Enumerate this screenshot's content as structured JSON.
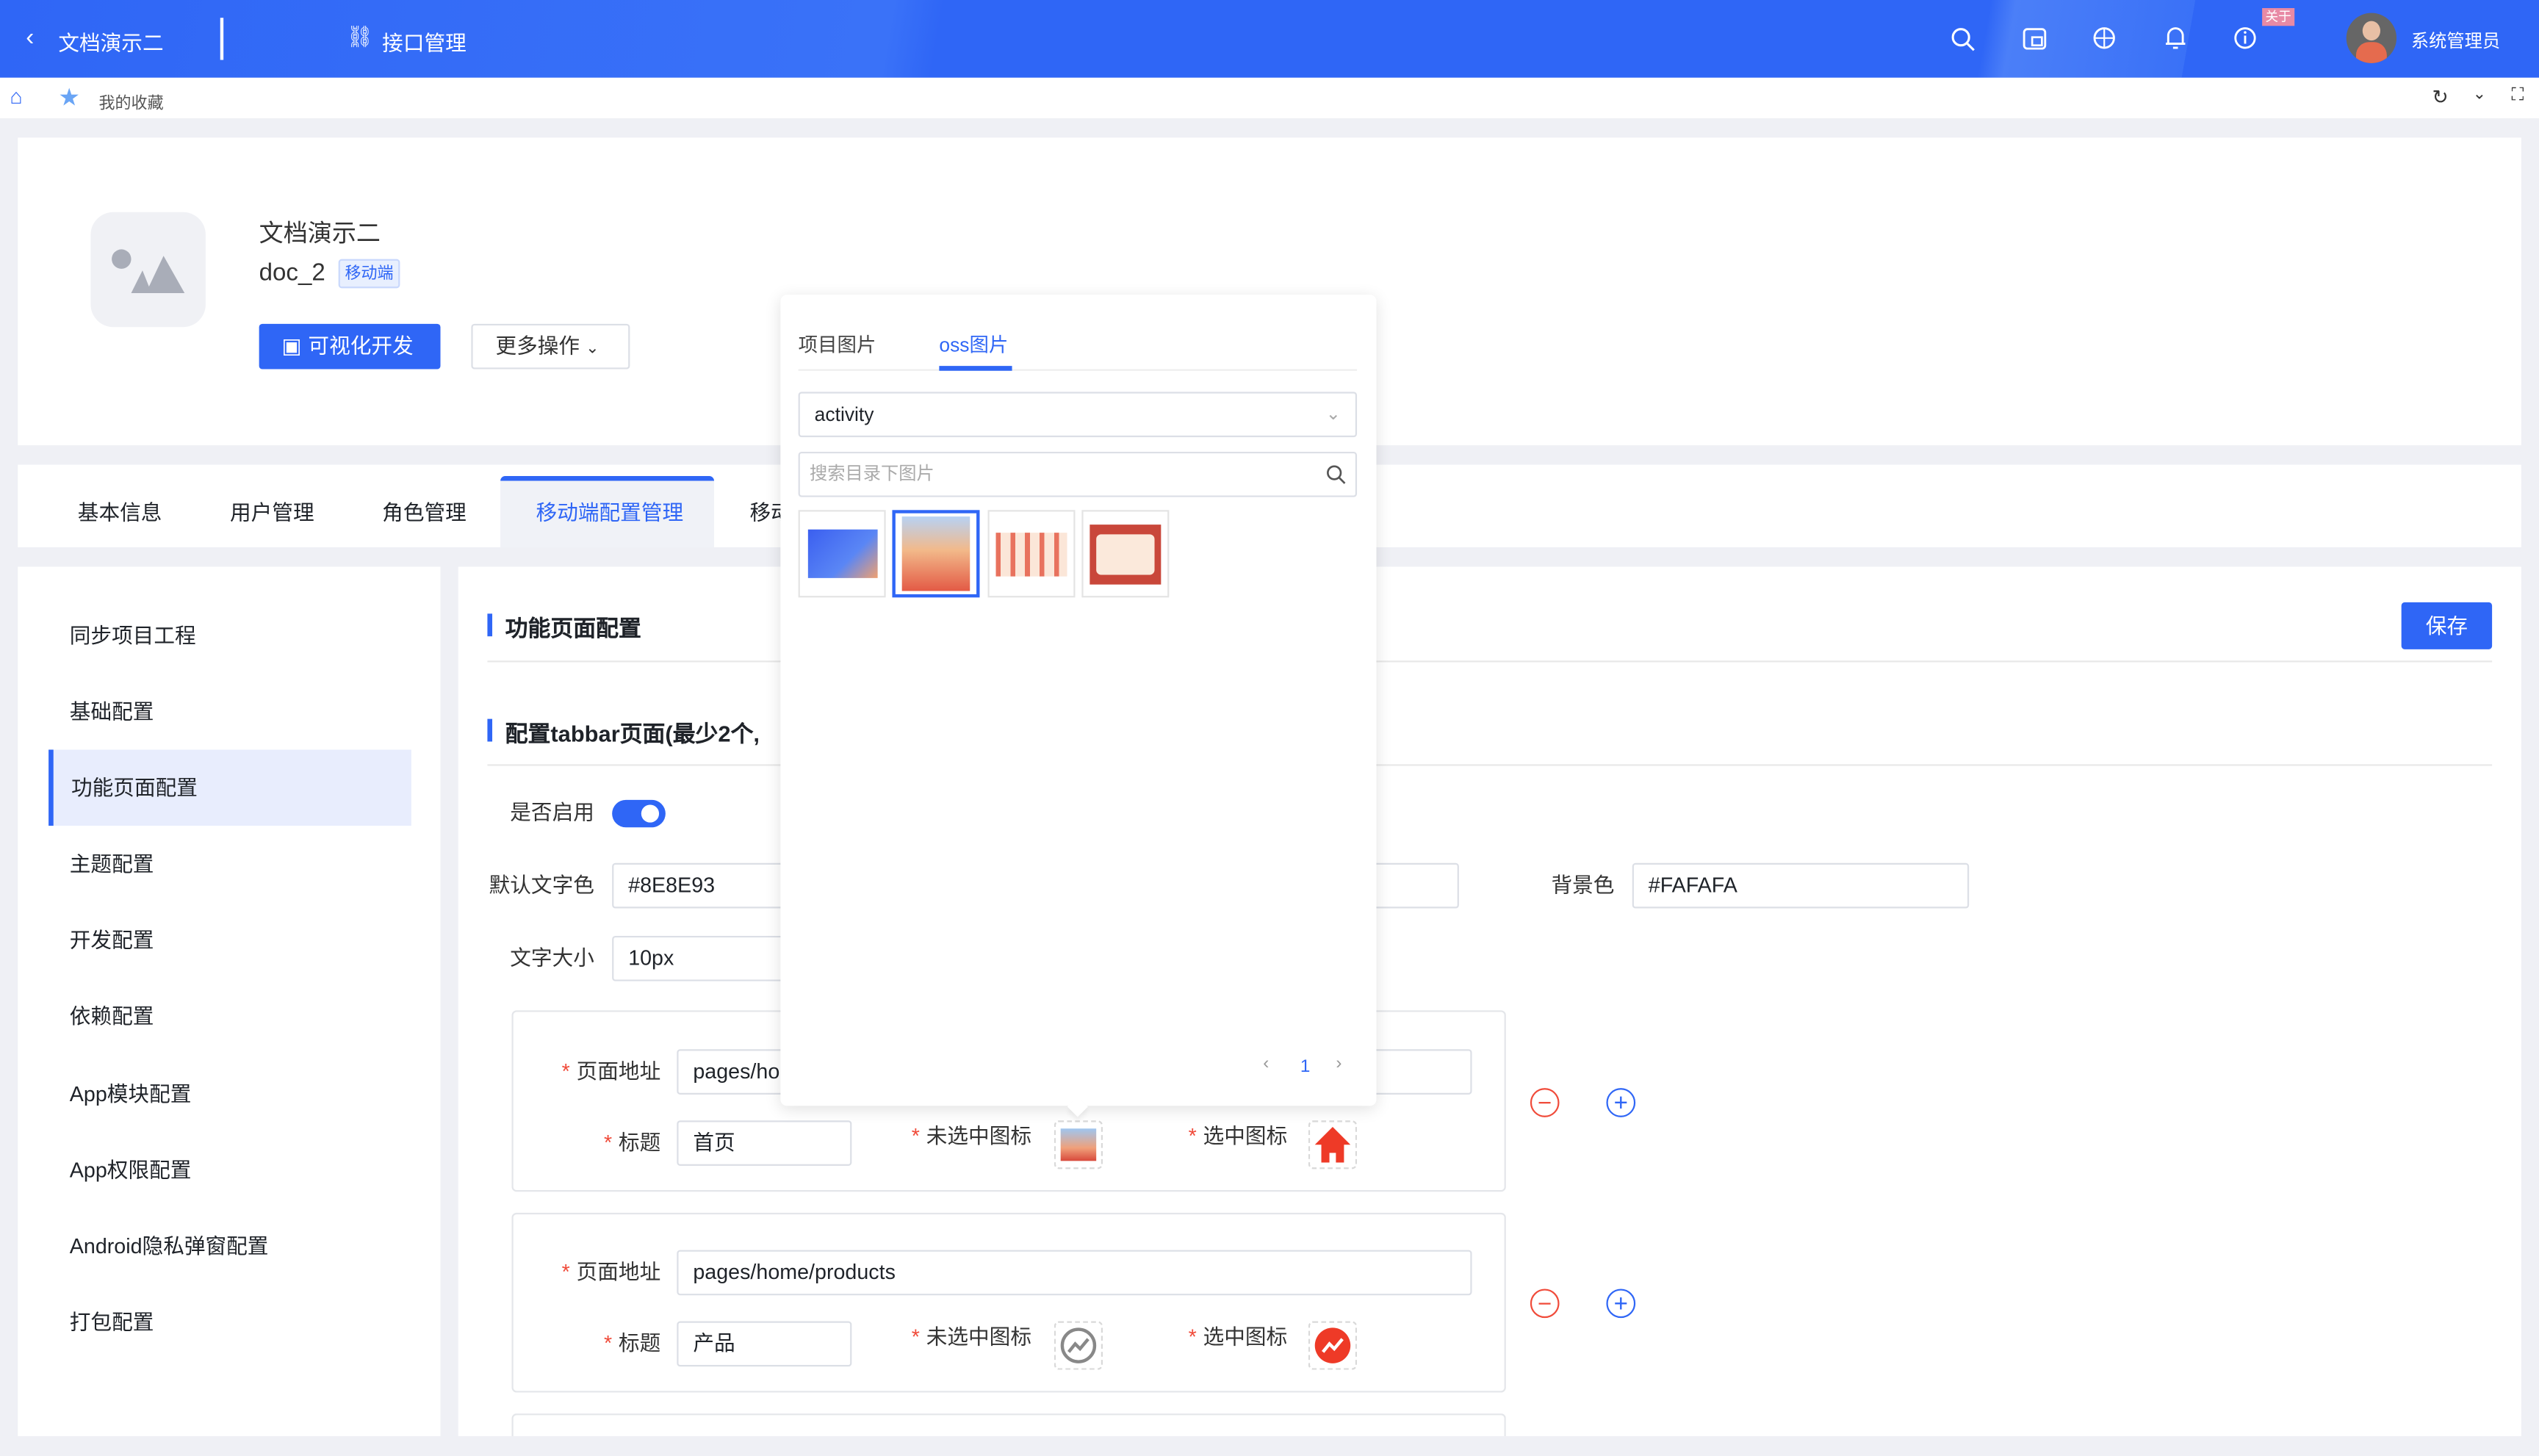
{
  "topbar": {
    "back_label": "文档演示二",
    "module_label": "接口管理",
    "badge": "关于",
    "user_name": "系统管理员",
    "icons": [
      "search-icon",
      "window-icon",
      "globe-icon",
      "bell-icon",
      "info-icon"
    ]
  },
  "bar2": {
    "favorites_label": "我的收藏"
  },
  "project": {
    "name": "文档演示二",
    "code": "doc_2",
    "tag": "移动端",
    "visual_dev_label": "可视化开发",
    "more_label": "更多操作"
  },
  "tabs": [
    {
      "label": "基本信息"
    },
    {
      "label": "用户管理"
    },
    {
      "label": "角色管理"
    },
    {
      "label": "移动端配置管理",
      "active": true
    },
    {
      "label": "移动"
    }
  ],
  "sidebar": {
    "items": [
      {
        "label": "同步项目工程"
      },
      {
        "label": "基础配置"
      },
      {
        "label": "功能页面配置",
        "active": true
      },
      {
        "label": "主题配置"
      },
      {
        "label": "开发配置"
      },
      {
        "label": "依赖配置"
      },
      {
        "label": "App模块配置"
      },
      {
        "label": "App权限配置"
      },
      {
        "label": "Android隐私弹窗配置"
      },
      {
        "label": "打包配置"
      }
    ]
  },
  "main": {
    "section_title": "功能页面配置",
    "save_label": "保存",
    "tabbar_title": "配置tabbar页面(最少2个,",
    "enable_label": "是否启用",
    "enabled": true,
    "text_color_label": "默认文字色",
    "text_color": "#8E8E93",
    "bg_color_label": "背景色",
    "bg_color": "#FAFAFA",
    "font_size_label": "文字大小",
    "font_size": "10px",
    "page_path_label": "页面地址",
    "title_label": "标题",
    "unselected_icon_label": "未选中图标",
    "selected_icon_label": "选中图标",
    "pages": [
      {
        "path": "pages/ho",
        "title": "首页",
        "selected_icon": "home-icon"
      },
      {
        "path": "pages/home/products",
        "title": "产品",
        "unselected_icon": "trend-up-icon",
        "selected_icon": "trend-up-icon"
      }
    ]
  },
  "popover": {
    "tabs": [
      {
        "label": "项目图片"
      },
      {
        "label": "oss图片",
        "active": true
      }
    ],
    "folder": "activity",
    "search_placeholder": "搜索目录下图片",
    "selected_index": 1,
    "page": "1"
  },
  "colors": {
    "primary": "#2F66F6",
    "danger": "#F04B3A"
  }
}
